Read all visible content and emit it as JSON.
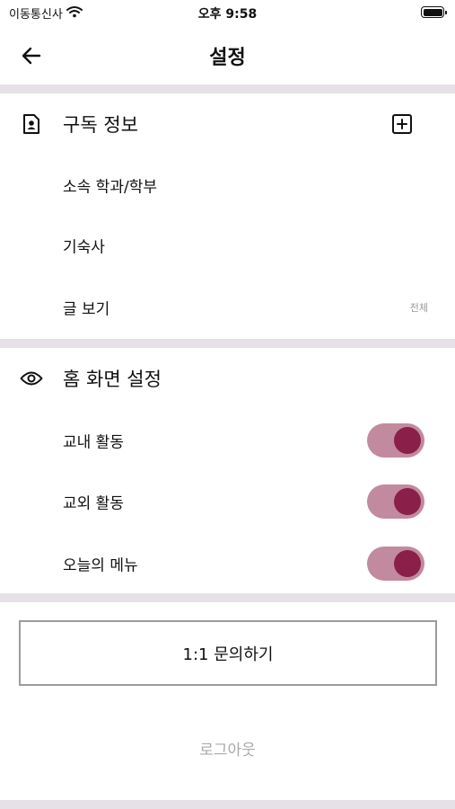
{
  "status_bar": {
    "carrier": "이동통신사",
    "time": "오후 9:58"
  },
  "header": {
    "title": "설정"
  },
  "subscription": {
    "title": "구독 정보",
    "items": [
      {
        "label": "소속 학과/학부",
        "value": ""
      },
      {
        "label": "기숙사",
        "value": ""
      },
      {
        "label": "글 보기",
        "value": "전체"
      }
    ]
  },
  "home_settings": {
    "title": "홈 화면 설정",
    "toggles": [
      {
        "label": "교내 활동",
        "on": true
      },
      {
        "label": "교외 활동",
        "on": true
      },
      {
        "label": "오늘의 메뉴",
        "on": true
      }
    ]
  },
  "actions": {
    "inquiry_label": "1:1 문의하기",
    "logout_label": "로그아웃"
  },
  "colors": {
    "toggle_track": "#c28a9e",
    "toggle_knob": "#8a1f4a",
    "divider": "#e6e1e6"
  }
}
